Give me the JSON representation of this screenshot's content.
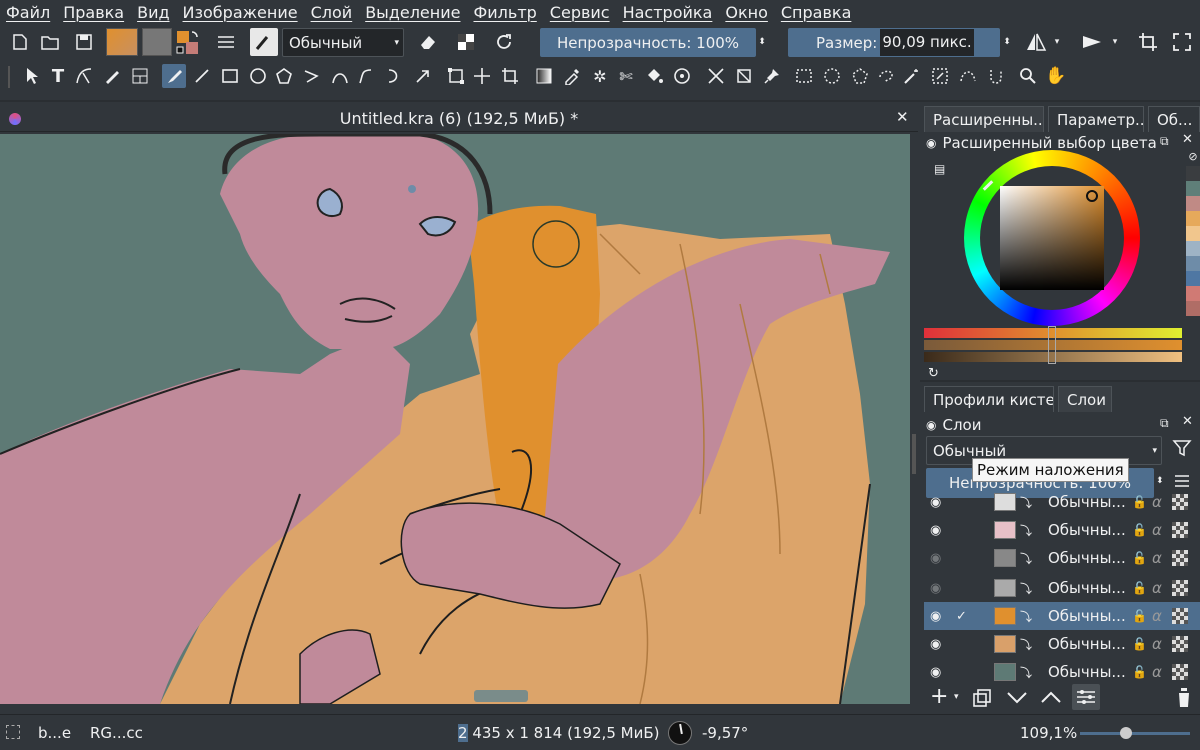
{
  "menu": [
    "Файл",
    "Правка",
    "Вид",
    "Изображение",
    "Слой",
    "Выделение",
    "Фильтр",
    "Сервис",
    "Настройка",
    "Окно",
    "Справка"
  ],
  "toolbar": {
    "blend_mode": "Обычный",
    "opacity_label": "Непрозрачность: 100%",
    "size_label": "Размер:",
    "size_value": "90,09 пикс.",
    "fg_color": "#e0902e",
    "bg_color": "#c57d78"
  },
  "document": {
    "title": "Untitled.kra (6) (192,5 МиБ) *"
  },
  "dock": {
    "top_tabs": [
      "Расширенны...",
      "Параметр...",
      "Об..."
    ],
    "color_panel_title": "Расширенный выбор цвета",
    "selected_color": "#e0902e",
    "swatches": [
      "#3a3d40",
      "#5f7f79",
      "#c08a85",
      "#e6a95b",
      "#f1c68d",
      "#9eb3c5",
      "#6e8ca8",
      "#4f77a3",
      "#d07a74",
      "#b06d66"
    ],
    "bottom_tabs": [
      "Профили кистей",
      "Слои"
    ],
    "layers_title": "Слои",
    "layers_blend": "Обычный",
    "tooltip": "Режим наложения",
    "layers_opacity": "Непрозрачность: 100%",
    "layers": [
      {
        "name": "Обычны...",
        "visible": true,
        "selected": false,
        "thumb": "#ddd"
      },
      {
        "name": "Обычны...",
        "visible": true,
        "selected": false,
        "thumb": "#e8c0c8"
      },
      {
        "name": "Обычны...",
        "visible": false,
        "selected": false,
        "thumb": "#888"
      },
      {
        "name": "Обычны...",
        "visible": false,
        "selected": false,
        "thumb": "#aaa"
      },
      {
        "name": "Обычны...",
        "visible": true,
        "selected": true,
        "thumb": "#e0902e"
      },
      {
        "name": "Обычны...",
        "visible": true,
        "selected": false,
        "thumb": "#d9a06a"
      },
      {
        "name": "Обычны...",
        "visible": true,
        "selected": false,
        "thumb": "#5e7a75"
      }
    ]
  },
  "status": {
    "brush": "b...e",
    "colorspace": "RG...cc",
    "dims_prefix": "2",
    "dims_rest": " 435 x 1 814 (192,5 МиБ)",
    "rotation": "-9,57°",
    "zoom": "109,1%"
  }
}
